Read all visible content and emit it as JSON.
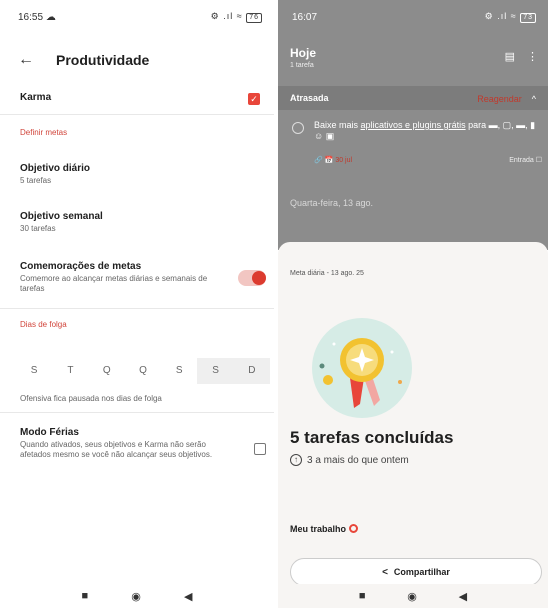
{
  "left": {
    "status": {
      "time": "16:55",
      "cloud": "☁",
      "icons": "⚙ .ıl ≈",
      "battery": "76"
    },
    "header": {
      "back": "←",
      "title": "Produtividade"
    },
    "karma": {
      "label": "Karma",
      "checked": "✓"
    },
    "section_goals": "Definir metas",
    "daily": {
      "label": "Objetivo diário",
      "value": "5 tarefas"
    },
    "weekly": {
      "label": "Objetivo semanal",
      "value": "30 tarefas"
    },
    "celebrations": {
      "label": "Comemorações de metas",
      "desc": "Comemore ao alcançar metas diárias e semanais de tarefas"
    },
    "section_days_off": "Dias de folga",
    "days": [
      "S",
      "T",
      "Q",
      "Q",
      "S",
      "S",
      "D"
    ],
    "days_off_note": "Ofensiva fica pausada nos dias de folga",
    "vacation": {
      "label": "Modo Férias",
      "desc": "Quando ativados, seus objetivos e Karma não serão afetados mesmo se você não alcançar seus objetivos."
    },
    "nav": {
      "recent": "■",
      "home": "◉",
      "back": "◀"
    }
  },
  "right": {
    "status": {
      "time": "16:07",
      "icons": "⚙ .ıl ≈",
      "battery": "73"
    },
    "title": "Hoje",
    "subtitle": "1 tarefa",
    "view_icon": "▤",
    "more_icon": "⋮",
    "overdue": {
      "label": "Atrasada",
      "action": "Reagendar",
      "chevron": "^"
    },
    "task": {
      "prefix": "Baixe mais ",
      "link": "aplicativos e plugins grátis",
      "suffix": " para ▬, ▢, ▬, ▮ ☺ ▣",
      "date": "30 jul",
      "project": "Entrada"
    },
    "date_header": "Quarta-feira, 13 ago.",
    "sheet": {
      "meta": "Meta diária - 13 ago. 25",
      "headline": "5 tarefas concluídas",
      "comparison": "3 a mais do que ontem",
      "work": "Meu trabalho",
      "share": "Compartilhar",
      "share_icon": "<"
    },
    "nav": {
      "recent": "■",
      "home": "◉",
      "back": "◀"
    }
  }
}
